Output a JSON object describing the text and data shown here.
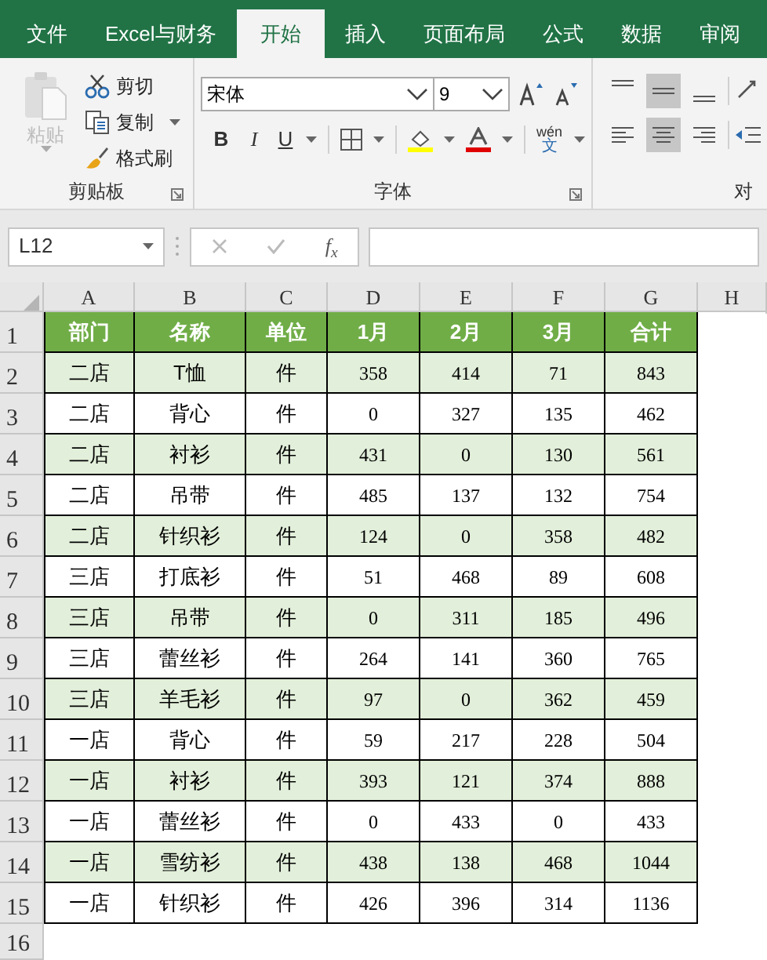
{
  "tabs": [
    {
      "label": "文件",
      "selected": false
    },
    {
      "label": "Excel与财务",
      "selected": false
    },
    {
      "label": "开始",
      "selected": true
    },
    {
      "label": "插入",
      "selected": false
    },
    {
      "label": "页面布局",
      "selected": false
    },
    {
      "label": "公式",
      "selected": false
    },
    {
      "label": "数据",
      "selected": false
    },
    {
      "label": "审阅",
      "selected": false
    }
  ],
  "ribbon": {
    "clipboard": {
      "paste": {
        "label": "粘贴",
        "disabled": true
      },
      "cut": "剪切",
      "copy": "复制",
      "format_painter": "格式刷",
      "label": "剪贴板"
    },
    "font": {
      "name": "宋体",
      "size": "9",
      "bold": "B",
      "italic": "I",
      "underline": "U",
      "phonetic": "wén",
      "phonetic_char": "文",
      "label": "字体"
    },
    "alignment": {
      "vertical": [
        {
          "selected": false
        },
        {
          "selected": true
        },
        {
          "selected": false
        }
      ],
      "horizontal": [
        {
          "selected": false
        },
        {
          "selected": true
        },
        {
          "selected": false
        }
      ],
      "label": "对"
    }
  },
  "formula_bar": {
    "name_box": "L12",
    "function": "f$_{x}$"
  },
  "sheet": {
    "columns": [
      "A",
      "B",
      "C",
      "D",
      "E",
      "F",
      "G",
      "H"
    ],
    "rows": [
      {
        "number": "1",
        "kind": "header",
        "cells": [
          "部门",
          "名称",
          "单位",
          "1月",
          "2月",
          "3月",
          "合计"
        ]
      },
      {
        "number": "2",
        "kind": "data",
        "shaded": true,
        "cells": [
          "二店",
          "T恤",
          "件",
          "358",
          "414",
          "71",
          "843"
        ]
      },
      {
        "number": "3",
        "kind": "data",
        "shaded": false,
        "cells": [
          "二店",
          "背心",
          "件",
          "0",
          "327",
          "135",
          "462"
        ]
      },
      {
        "number": "4",
        "kind": "data",
        "shaded": true,
        "cells": [
          "二店",
          "衬衫",
          "件",
          "431",
          "0",
          "130",
          "561"
        ]
      },
      {
        "number": "5",
        "kind": "data",
        "shaded": false,
        "cells": [
          "二店",
          "吊带",
          "件",
          "485",
          "137",
          "132",
          "754"
        ]
      },
      {
        "number": "6",
        "kind": "data",
        "shaded": true,
        "cells": [
          "二店",
          "针织衫",
          "件",
          "124",
          "0",
          "358",
          "482"
        ]
      },
      {
        "number": "7",
        "kind": "data",
        "shaded": false,
        "cells": [
          "三店",
          "打底衫",
          "件",
          "51",
          "468",
          "89",
          "608"
        ]
      },
      {
        "number": "8",
        "kind": "data",
        "shaded": true,
        "cells": [
          "三店",
          "吊带",
          "件",
          "0",
          "311",
          "185",
          "496"
        ]
      },
      {
        "number": "9",
        "kind": "data",
        "shaded": false,
        "cells": [
          "三店",
          "蕾丝衫",
          "件",
          "264",
          "141",
          "360",
          "765"
        ]
      },
      {
        "number": "10",
        "kind": "data",
        "shaded": true,
        "cells": [
          "三店",
          "羊毛衫",
          "件",
          "97",
          "0",
          "362",
          "459"
        ]
      },
      {
        "number": "11",
        "kind": "data",
        "shaded": false,
        "cells": [
          "一店",
          "背心",
          "件",
          "59",
          "217",
          "228",
          "504"
        ]
      },
      {
        "number": "12",
        "kind": "data",
        "shaded": true,
        "cells": [
          "一店",
          "衬衫",
          "件",
          "393",
          "121",
          "374",
          "888"
        ]
      },
      {
        "number": "13",
        "kind": "data",
        "shaded": false,
        "cells": [
          "一店",
          "蕾丝衫",
          "件",
          "0",
          "433",
          "0",
          "433"
        ]
      },
      {
        "number": "14",
        "kind": "data",
        "shaded": true,
        "cells": [
          "一店",
          "雪纺衫",
          "件",
          "438",
          "138",
          "468",
          "1044"
        ]
      },
      {
        "number": "15",
        "kind": "data",
        "shaded": false,
        "cells": [
          "一店",
          "针织衫",
          "件",
          "426",
          "396",
          "314",
          "1136"
        ]
      },
      {
        "number": "16",
        "kind": "empty",
        "cells": []
      }
    ]
  }
}
